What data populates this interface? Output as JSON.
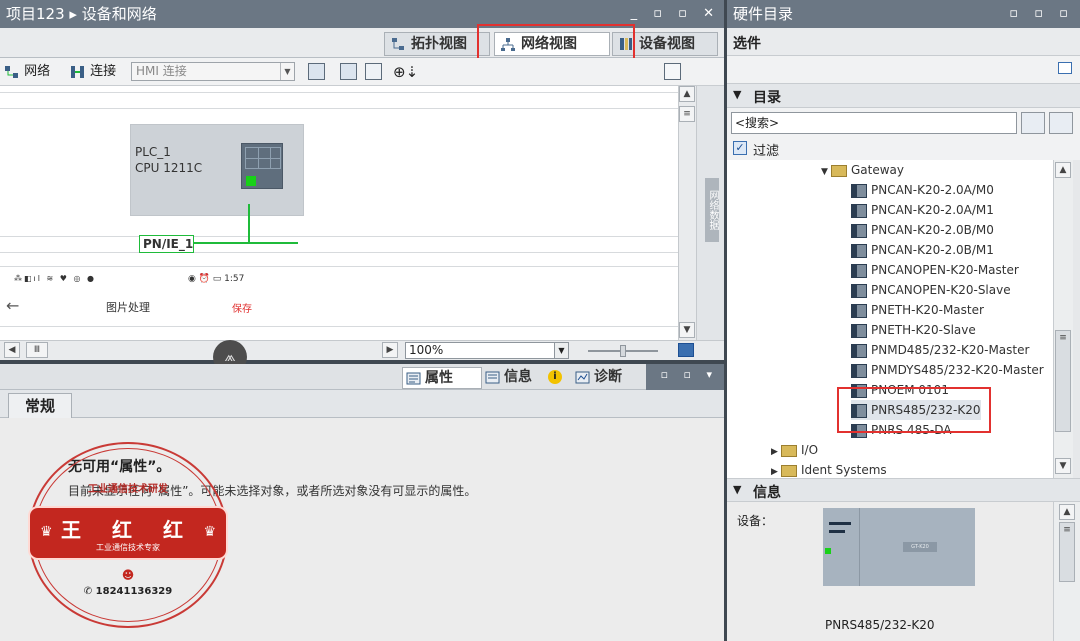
{
  "left_window": {
    "title": "项目123 ▸ 设备和网络",
    "controls": "_ ▫ ▫ ✕"
  },
  "right_window": {
    "title": "硬件目录",
    "controls": "▫ ▫ ▫"
  },
  "view_tabs": [
    {
      "label": "拓扑视图"
    },
    {
      "label": "网络视图"
    },
    {
      "label": "设备视图"
    }
  ],
  "toolbar": {
    "network_label": "网络",
    "connection_label": "连接",
    "hmi_combo": "HMI 连接"
  },
  "canvas": {
    "plc_name": "PLC_1",
    "plc_cpu": "CPU 1211C",
    "pn_label": "PN/IE_1",
    "status_icons": "⁂◧ıl ≋ ♥ ◎ ●",
    "status_time": "◉ ⏰ ▭ 1:57",
    "back_arrow": "←",
    "photo_label": "图片处理",
    "save_label": "保存",
    "side_tab": "网络数据"
  },
  "zoom": {
    "value": "100%"
  },
  "inspector": {
    "tabs": [
      {
        "label": "属性"
      },
      {
        "label": "信息"
      },
      {
        "label": "诊断"
      }
    ],
    "general_tab": "常规",
    "no_prop_title": "无可用“属性”。",
    "no_prop_desc": "目前未显示任何“属性”。可能未选择对象，或者所选对象没有可显示的属性。"
  },
  "stamp": {
    "top_text": "工业通信技术研发",
    "name": "王 红 红",
    "title": "工业通信技术专家",
    "phone": "18241136329",
    "chat_icon": "☻"
  },
  "catalog": {
    "options_label": "选件",
    "catalog_label": "目录",
    "search_placeholder": "<搜索>",
    "filter_label": "过滤",
    "filter_checked": true,
    "tree": {
      "gateway_folder": "Gateway",
      "devices": [
        "PNCAN-K20-2.0A/M0",
        "PNCAN-K20-2.0A/M1",
        "PNCAN-K20-2.0B/M0",
        "PNCAN-K20-2.0B/M1",
        "PNCANOPEN-K20-Master",
        "PNCANOPEN-K20-Slave",
        "PNETH-K20-Master",
        "PNETH-K20-Slave",
        "PNMD485/232-K20-Master",
        "PNMDYS485/232-K20-Master",
        "PNOEM 0101",
        "PNRS485/232-K20",
        "PNRS 485-DA"
      ],
      "other_folders": [
        "I/O",
        "Ident Systems"
      ]
    }
  },
  "info_panel": {
    "header": "信息",
    "device_label": "设备：",
    "device_name": "PNRS485/232-K20",
    "device_image_label": "GT-K20"
  },
  "colors": {
    "title_bar": "#6b7784",
    "highlight_red": "#e2312f",
    "network_green": "#1fbb3a",
    "stamp_red": "#c3271f"
  }
}
